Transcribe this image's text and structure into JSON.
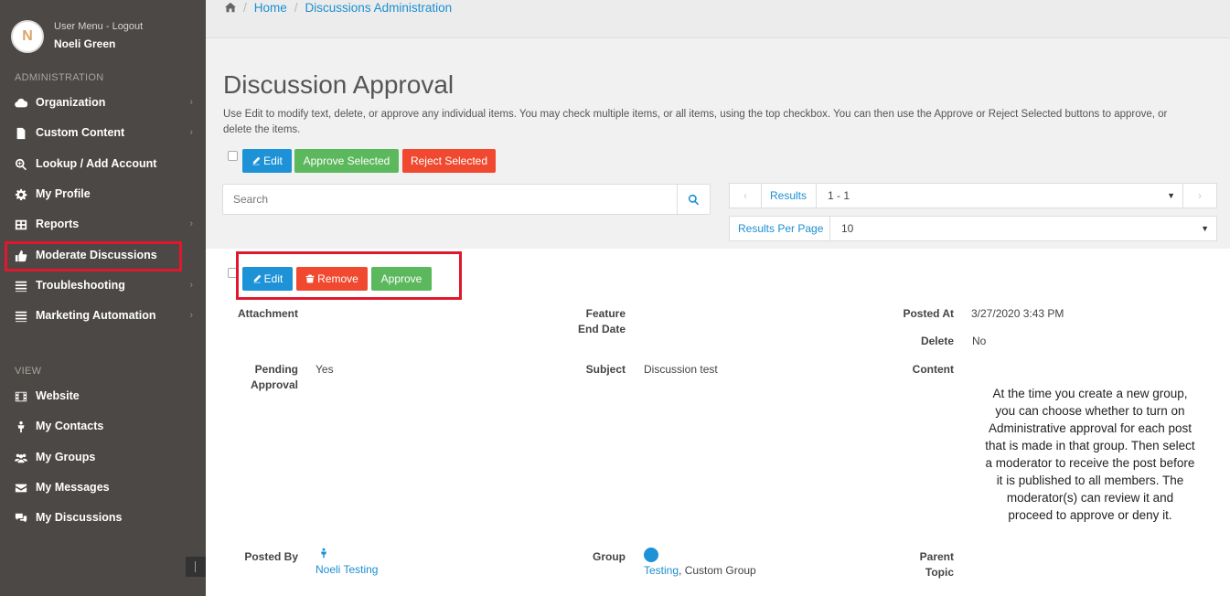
{
  "user": {
    "avatar_initial": "N",
    "menu_label": "User Menu - Logout",
    "name": "Noeli Green"
  },
  "sidebar": {
    "admin_label": "ADMINISTRATION",
    "view_label": "VIEW",
    "admin_items": [
      {
        "label": "Organization",
        "icon": "cloud-icon",
        "has_children": true
      },
      {
        "label": "Custom Content",
        "icon": "file-icon",
        "has_children": true
      },
      {
        "label": "Lookup / Add Account",
        "icon": "search-plus-icon",
        "has_children": false
      },
      {
        "label": "My Profile",
        "icon": "gear-icon",
        "has_children": false
      },
      {
        "label": "Reports",
        "icon": "table-icon",
        "has_children": true
      },
      {
        "label": "Moderate Discussions",
        "icon": "thumbs-up-icon",
        "has_children": false,
        "highlighted": true
      },
      {
        "label": "Troubleshooting",
        "icon": "list-icon",
        "has_children": true
      },
      {
        "label": "Marketing Automation",
        "icon": "list-icon",
        "has_children": true
      }
    ],
    "view_items": [
      {
        "label": "Website",
        "icon": "film-icon"
      },
      {
        "label": "My Contacts",
        "icon": "person-icon"
      },
      {
        "label": "My Groups",
        "icon": "users-icon"
      },
      {
        "label": "My Messages",
        "icon": "envelope-icon"
      },
      {
        "label": "My Discussions",
        "icon": "comments-icon"
      }
    ]
  },
  "breadcrumb": {
    "home": "Home",
    "current": "Discussions Administration"
  },
  "page": {
    "title": "Discussion Approval",
    "intro": "Use Edit to modify text, delete, or approve any individual items. You may check multiple items, or all items, using the top checkbox. You can then use the Approve or Reject Selected buttons to approve, or delete the items."
  },
  "toolbar": {
    "edit_label": "Edit",
    "approve_selected_label": "Approve Selected",
    "reject_selected_label": "Reject Selected"
  },
  "search": {
    "placeholder": "Search"
  },
  "pager": {
    "results_label": "Results",
    "results_value": "1 - 1",
    "per_page_label": "Results Per Page",
    "per_page_value": "10"
  },
  "record": {
    "edit_label": "Edit",
    "remove_label": "Remove",
    "approve_label": "Approve",
    "fields": {
      "attachment_label": "Attachment",
      "feature_end_label_1": "Feature",
      "feature_end_label_2": "End Date",
      "posted_at_label": "Posted At",
      "posted_at_value": "3/27/2020 3:43 PM",
      "delete_label": "Delete",
      "delete_value": "No",
      "pending_label_1": "Pending",
      "pending_label_2": "Approval",
      "pending_value": "Yes",
      "subject_label": "Subject",
      "subject_value": "Discussion test",
      "content_label": "Content",
      "content_value": "At the time you create a new group, you can choose whether to turn on Administrative approval for each post that is made in that group. Then select a moderator to receive the post before it is published to all members. The moderator(s) can review it and proceed to approve or deny it.",
      "posted_by_label": "Posted By",
      "posted_by_value": "Noeli Testing",
      "group_label": "Group",
      "group_link": "Testing",
      "group_suffix": ", Custom Group",
      "parent_topic_label_1": "Parent",
      "parent_topic_label_2": "Topic"
    }
  },
  "colors": {
    "sidebar_bg": "#4b4845",
    "link_blue": "#1b8fd1",
    "button_blue": "#1d92d6",
    "button_green": "#5cb85c",
    "button_red": "#f0492f",
    "highlight_red": "#e0182d"
  }
}
